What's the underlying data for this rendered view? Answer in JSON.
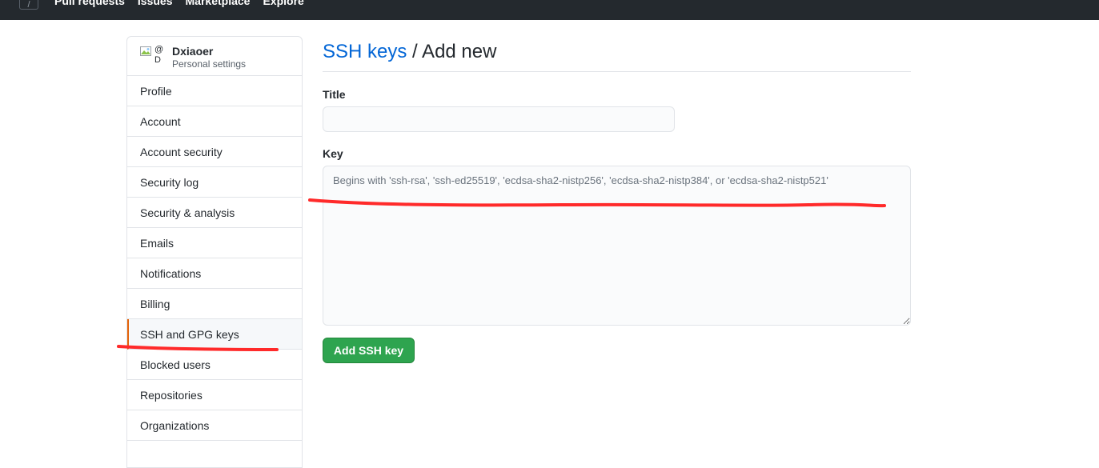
{
  "topbar": {
    "slash_glyph": "/",
    "nav": [
      "Pull requests",
      "Issues",
      "Marketplace",
      "Explore"
    ]
  },
  "user": {
    "avatar_alt": "@D",
    "avatar_line1": "@",
    "avatar_line2": "D",
    "name": "Dxiaoer",
    "subtitle": "Personal settings"
  },
  "sidebar": {
    "items": [
      {
        "label": "Profile"
      },
      {
        "label": "Account"
      },
      {
        "label": "Account security"
      },
      {
        "label": "Security log"
      },
      {
        "label": "Security & analysis"
      },
      {
        "label": "Emails"
      },
      {
        "label": "Notifications"
      },
      {
        "label": "Billing"
      },
      {
        "label": "SSH and GPG keys",
        "selected": true
      },
      {
        "label": "Blocked users"
      },
      {
        "label": "Repositories"
      },
      {
        "label": "Organizations"
      }
    ]
  },
  "page": {
    "breadcrumb_link": "SSH keys",
    "breadcrumb_rest": " / Add new",
    "title_label": "Title",
    "title_value": "",
    "key_label": "Key",
    "key_placeholder": "Begins with 'ssh-rsa', 'ssh-ed25519', 'ecdsa-sha2-nistp256', 'ecdsa-sha2-nistp384', or 'ecdsa-sha2-nistp521'",
    "submit_label": "Add SSH key"
  },
  "colors": {
    "accent_link": "#0366d6",
    "button_green": "#2ea44f",
    "annotation_red": "#ff2a2a",
    "selected_marker": "#e36209"
  }
}
